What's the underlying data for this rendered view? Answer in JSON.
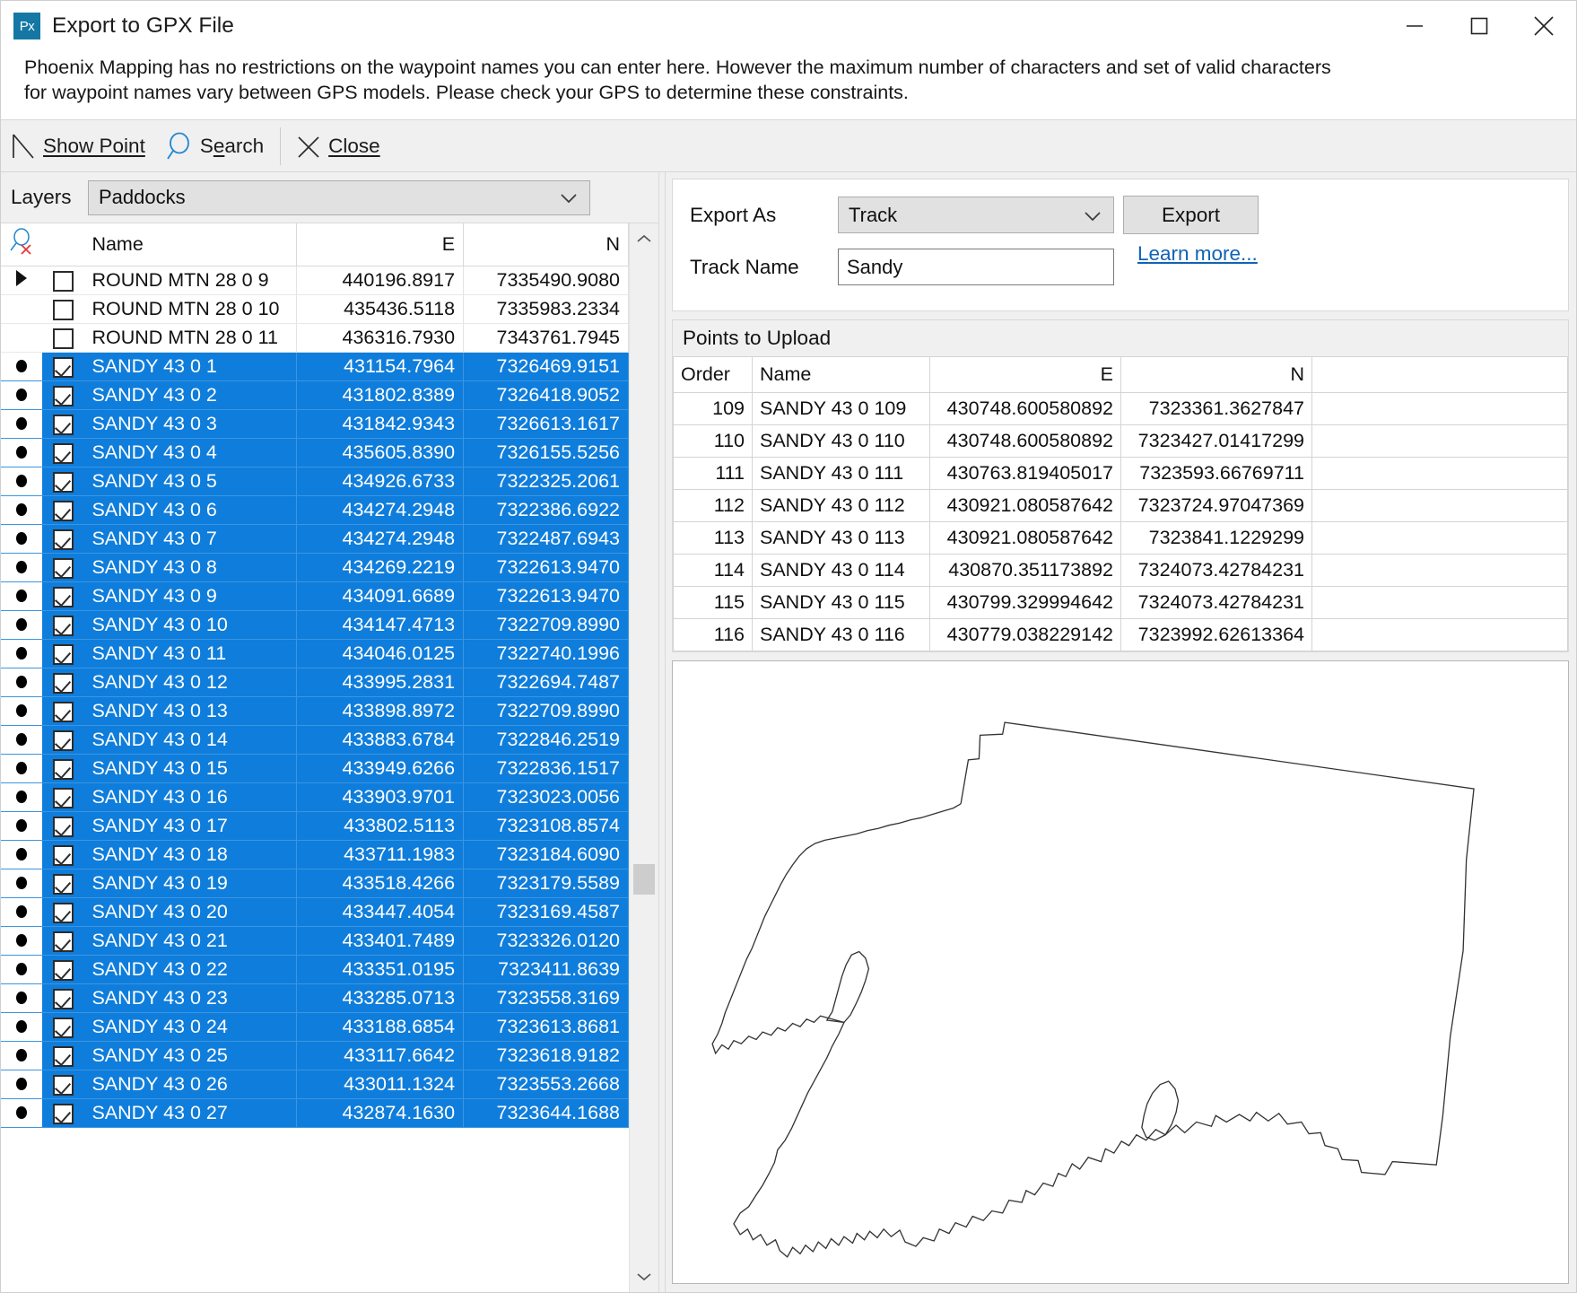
{
  "window": {
    "title": "Export to GPX File",
    "icon_label": "Px",
    "minimize_label": "Minimize",
    "maximize_label": "Maximize",
    "close_label": "Close"
  },
  "description": "Phoenix Mapping has no restrictions on the waypoint names you can enter here. However the maximum number of characters and set of valid characters for waypoint names vary between GPS models. Please check your GPS to determine these constraints.",
  "toolbar": {
    "show_point": "Show Point",
    "search": "Search",
    "close": "Close"
  },
  "layers": {
    "label": "Layers",
    "selected": "Paddocks"
  },
  "grid": {
    "headers": {
      "name": "Name",
      "e": "E",
      "n": "N"
    },
    "rows": [
      {
        "mark": "arrow",
        "checked": false,
        "name": "ROUND MTN 28 0 9",
        "e": "440196.8917",
        "n": "7335490.9080",
        "selected": false
      },
      {
        "mark": "none",
        "checked": false,
        "name": "ROUND MTN 28 0 10",
        "e": "435436.5118",
        "n": "7335983.2334",
        "selected": false
      },
      {
        "mark": "none",
        "checked": false,
        "name": "ROUND MTN 28 0 11",
        "e": "436316.7930",
        "n": "7343761.7945",
        "selected": false
      },
      {
        "mark": "dot",
        "checked": true,
        "name": "SANDY 43 0 1",
        "e": "431154.7964",
        "n": "7326469.9151",
        "selected": true
      },
      {
        "mark": "dot",
        "checked": true,
        "name": "SANDY 43 0 2",
        "e": "431802.8389",
        "n": "7326418.9052",
        "selected": true
      },
      {
        "mark": "dot",
        "checked": true,
        "name": "SANDY 43 0 3",
        "e": "431842.9343",
        "n": "7326613.1617",
        "selected": true
      },
      {
        "mark": "dot",
        "checked": true,
        "name": "SANDY 43 0 4",
        "e": "435605.8390",
        "n": "7326155.5256",
        "selected": true
      },
      {
        "mark": "dot",
        "checked": true,
        "name": "SANDY 43 0 5",
        "e": "434926.6733",
        "n": "7322325.2061",
        "selected": true
      },
      {
        "mark": "dot",
        "checked": true,
        "name": "SANDY 43 0 6",
        "e": "434274.2948",
        "n": "7322386.6922",
        "selected": true
      },
      {
        "mark": "dot",
        "checked": true,
        "name": "SANDY 43 0 7",
        "e": "434274.2948",
        "n": "7322487.6943",
        "selected": true
      },
      {
        "mark": "dot",
        "checked": true,
        "name": "SANDY 43 0 8",
        "e": "434269.2219",
        "n": "7322613.9470",
        "selected": true
      },
      {
        "mark": "dot",
        "checked": true,
        "name": "SANDY 43 0 9",
        "e": "434091.6689",
        "n": "7322613.9470",
        "selected": true
      },
      {
        "mark": "dot",
        "checked": true,
        "name": "SANDY 43 0 10",
        "e": "434147.4713",
        "n": "7322709.8990",
        "selected": true
      },
      {
        "mark": "dot",
        "checked": true,
        "name": "SANDY 43 0 11",
        "e": "434046.0125",
        "n": "7322740.1996",
        "selected": true
      },
      {
        "mark": "dot",
        "checked": true,
        "name": "SANDY 43 0 12",
        "e": "433995.2831",
        "n": "7322694.7487",
        "selected": true
      },
      {
        "mark": "dot",
        "checked": true,
        "name": "SANDY 43 0 13",
        "e": "433898.8972",
        "n": "7322709.8990",
        "selected": true
      },
      {
        "mark": "dot",
        "checked": true,
        "name": "SANDY 43 0 14",
        "e": "433883.6784",
        "n": "7322846.2519",
        "selected": true
      },
      {
        "mark": "dot",
        "checked": true,
        "name": "SANDY 43 0 15",
        "e": "433949.6266",
        "n": "7322836.1517",
        "selected": true
      },
      {
        "mark": "dot",
        "checked": true,
        "name": "SANDY 43 0 16",
        "e": "433903.9701",
        "n": "7323023.0056",
        "selected": true
      },
      {
        "mark": "dot",
        "checked": true,
        "name": "SANDY 43 0 17",
        "e": "433802.5113",
        "n": "7323108.8574",
        "selected": true
      },
      {
        "mark": "dot",
        "checked": true,
        "name": "SANDY 43 0 18",
        "e": "433711.1983",
        "n": "7323184.6090",
        "selected": true
      },
      {
        "mark": "dot",
        "checked": true,
        "name": "SANDY 43 0 19",
        "e": "433518.4266",
        "n": "7323179.5589",
        "selected": true
      },
      {
        "mark": "dot",
        "checked": true,
        "name": "SANDY 43 0 20",
        "e": "433447.4054",
        "n": "7323169.4587",
        "selected": true
      },
      {
        "mark": "dot",
        "checked": true,
        "name": "SANDY 43 0 21",
        "e": "433401.7489",
        "n": "7323326.0120",
        "selected": true
      },
      {
        "mark": "dot",
        "checked": true,
        "name": "SANDY 43 0 22",
        "e": "433351.0195",
        "n": "7323411.8639",
        "selected": true
      },
      {
        "mark": "dot",
        "checked": true,
        "name": "SANDY 43 0 23",
        "e": "433285.0713",
        "n": "7323558.3169",
        "selected": true
      },
      {
        "mark": "dot",
        "checked": true,
        "name": "SANDY 43 0 24",
        "e": "433188.6854",
        "n": "7323613.8681",
        "selected": true
      },
      {
        "mark": "dot",
        "checked": true,
        "name": "SANDY 43 0 25",
        "e": "433117.6642",
        "n": "7323618.9182",
        "selected": true
      },
      {
        "mark": "dot",
        "checked": true,
        "name": "SANDY 43 0 26",
        "e": "433011.1324",
        "n": "7323553.2668",
        "selected": true
      },
      {
        "mark": "dot",
        "checked": true,
        "name": "SANDY 43 0 27",
        "e": "432874.1630",
        "n": "7323644.1688",
        "selected": true
      }
    ]
  },
  "export": {
    "export_as_label": "Export As",
    "export_as_value": "Track",
    "track_name_label": "Track Name",
    "track_name_value": "Sandy",
    "export_button": "Export",
    "learn_more": "Learn more..."
  },
  "points": {
    "title": "Points to Upload",
    "headers": {
      "order": "Order",
      "name": "Name",
      "e": "E",
      "n": "N"
    },
    "rows": [
      {
        "order": "109",
        "name": "SANDY 43 0 109",
        "e": "430748.600580892",
        "n": "7323361.3627847"
      },
      {
        "order": "110",
        "name": "SANDY 43 0 110",
        "e": "430748.600580892",
        "n": "7323427.01417299"
      },
      {
        "order": "111",
        "name": "SANDY 43 0 111",
        "e": "430763.819405017",
        "n": "7323593.66769711"
      },
      {
        "order": "112",
        "name": "SANDY 43 0 112",
        "e": "430921.080587642",
        "n": "7323724.97047369"
      },
      {
        "order": "113",
        "name": "SANDY 43 0 113",
        "e": "430921.080587642",
        "n": "7323841.1229299"
      },
      {
        "order": "114",
        "name": "SANDY 43 0 114",
        "e": "430870.351173892",
        "n": "7324073.42784231"
      },
      {
        "order": "115",
        "name": "SANDY 43 0 115",
        "e": "430799.329994642",
        "n": "7324073.42784231"
      },
      {
        "order": "116",
        "name": "SANDY 43 0 116",
        "e": "430779.038229142",
        "n": "7323992.62613364"
      }
    ]
  },
  "colors": {
    "selection": "#0f7ddb",
    "link": "#1063b5",
    "accent": "#1577a3"
  }
}
